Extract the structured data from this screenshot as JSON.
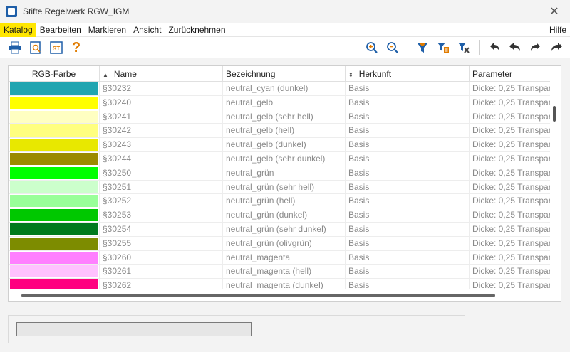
{
  "window": {
    "title": "Stifte Regelwerk RGW_IGM",
    "close_glyph": "✕"
  },
  "menu": {
    "items": [
      "Katalog",
      "Bearbeiten",
      "Markieren",
      "Ansicht",
      "Zurücknehmen"
    ],
    "active": "Katalog",
    "help": "Hilfe"
  },
  "toolbar": {
    "buttons": [
      "print-icon",
      "print-preview-icon",
      "stats-icon",
      "help-icon",
      "zoom-in-icon",
      "zoom-out-icon",
      "filter-icon",
      "filter-edit-icon",
      "filter-remove-icon",
      "undo-icon",
      "undo-all-icon",
      "redo-icon",
      "redo-all-icon"
    ],
    "stats_label": "ST",
    "help_glyph": "?"
  },
  "grid": {
    "columns": [
      "RGB-Farbe",
      "Name",
      "Bezeichnung",
      "Herkunft",
      "Parameter"
    ],
    "rows": [
      {
        "color": "#21a5b1",
        "name": "§30232",
        "desc": "neutral_cyan (dunkel)",
        "origin": "Basis",
        "param": "Dicke: 0,25 Transpar"
      },
      {
        "color": "#ffff00",
        "name": "§30240",
        "desc": "neutral_gelb",
        "origin": "Basis",
        "param": "Dicke: 0,25 Transpar"
      },
      {
        "color": "#ffffc2",
        "name": "§30241",
        "desc": "neutral_gelb (sehr hell)",
        "origin": "Basis",
        "param": "Dicke: 0,25 Transpar"
      },
      {
        "color": "#ffff80",
        "name": "§30242",
        "desc": "neutral_gelb (hell)",
        "origin": "Basis",
        "param": "Dicke: 0,25 Transpar"
      },
      {
        "color": "#e8e800",
        "name": "§30243",
        "desc": "neutral_gelb (dunkel)",
        "origin": "Basis",
        "param": "Dicke: 0,25 Transpar"
      },
      {
        "color": "#9a8a00",
        "name": "§30244",
        "desc": "neutral_gelb (sehr dunkel)",
        "origin": "Basis",
        "param": "Dicke: 0,25 Transpar"
      },
      {
        "color": "#00ff00",
        "name": "§30250",
        "desc": "neutral_grün",
        "origin": "Basis",
        "param": "Dicke: 0,25 Transpar"
      },
      {
        "color": "#ccffcc",
        "name": "§30251",
        "desc": "neutral_grün (sehr hell)",
        "origin": "Basis",
        "param": "Dicke: 0,25 Transpar"
      },
      {
        "color": "#99ff99",
        "name": "§30252",
        "desc": "neutral_grün (hell)",
        "origin": "Basis",
        "param": "Dicke: 0,25 Transpar"
      },
      {
        "color": "#00c800",
        "name": "§30253",
        "desc": "neutral_grün (dunkel)",
        "origin": "Basis",
        "param": "Dicke: 0,25 Transpar"
      },
      {
        "color": "#007a1e",
        "name": "§30254",
        "desc": "neutral_grün (sehr dunkel)",
        "origin": "Basis",
        "param": "Dicke: 0,25 Transpar"
      },
      {
        "color": "#7d8c00",
        "name": "§30255",
        "desc": "neutral_grün (olivgrün)",
        "origin": "Basis",
        "param": "Dicke: 0,25 Transpar"
      },
      {
        "color": "#ff80ff",
        "name": "§30260",
        "desc": "neutral_magenta",
        "origin": "Basis",
        "param": "Dicke: 0,25 Transpar"
      },
      {
        "color": "#ffc2ff",
        "name": "§30261",
        "desc": "neutral_magenta (hell)",
        "origin": "Basis",
        "param": "Dicke: 0,25 Transpar"
      },
      {
        "color": "#ff0080",
        "name": "§30262",
        "desc": "neutral_magenta (dunkel)",
        "origin": "Basis",
        "param": "Dicke: 0,25 Transpar"
      }
    ]
  },
  "status": {
    "progress": 0
  }
}
